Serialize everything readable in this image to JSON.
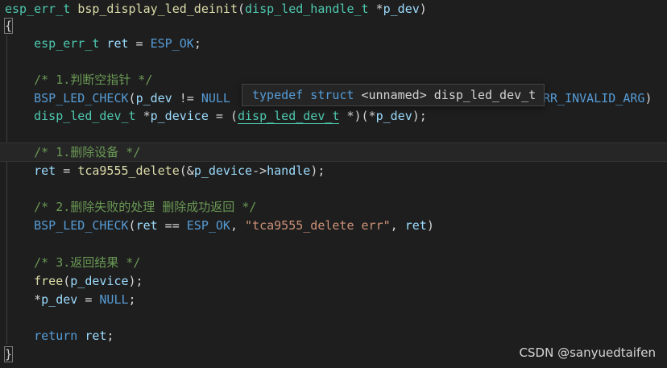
{
  "code": {
    "l1": {
      "ret_type": "esp_err_t",
      "fn": "bsp_display_led_deinit",
      "open": "(",
      "ptype": "disp_led_handle_t",
      "ptr": " *",
      "pname": "p_dev",
      "close": ")"
    },
    "l2": {
      "brace": "{"
    },
    "l3": {
      "type": "esp_err_t",
      "var": "ret",
      "eq": " = ",
      "val": "ESP_OK",
      "end": ";"
    },
    "l5": {
      "comment": "/* 1.判断空指针 */"
    },
    "l6": {
      "macro": "BSP_LED_CHECK",
      "open": "(",
      "var": "p_dev",
      "op": " != ",
      "null": "NULL",
      "tail_macro": "RR_INVALID_ARG",
      "tail_close": ")"
    },
    "l7": {
      "type": "disp_led_dev_t",
      "ptr": " *",
      "var": "p_device",
      "eq": " = (",
      "cast": "disp_led_dev_t",
      "cast_rest": " *)(*",
      "src": "p_dev",
      "end": ");"
    },
    "l9": {
      "comment": "/* 1.删除设备 */"
    },
    "l10": {
      "var": "ret",
      "eq": " = ",
      "fn": "tca9555_delete",
      "args": "(&",
      "arg": "p_device",
      "arrow": "->",
      "field": "handle",
      "end": ");"
    },
    "l12": {
      "comment": "/* 2.删除失败的处理 删除成功返回 */"
    },
    "l13": {
      "macro": "BSP_LED_CHECK",
      "open": "(",
      "var": "ret",
      "op": " == ",
      "ok": "ESP_OK",
      "comma": ", ",
      "str": "\"tca9555_delete err\"",
      "comma2": ", ",
      "var2": "ret",
      "end": ")"
    },
    "l15": {
      "comment": "/* 3.返回结果 */"
    },
    "l16": {
      "fn": "free",
      "open": "(",
      "var": "p_device",
      "end": ");"
    },
    "l17": {
      "ptr": "*",
      "var": "p_dev",
      "eq": " = ",
      "null": "NULL",
      "end": ";"
    },
    "l19": {
      "kw": "return",
      "sp": " ",
      "var": "ret",
      "end": ";"
    },
    "l20": {
      "brace": "}"
    }
  },
  "tooltip": {
    "kw1": "typedef",
    "kw2": "struct",
    "unnamed": "<unnamed>",
    "name": "disp_led_dev_t"
  },
  "watermark": "CSDN @sanyuedtaifen",
  "colors": {
    "background": "#1e1e1e",
    "type": "#4ec9b0",
    "keyword": "#569cd6",
    "function": "#dcdcaa",
    "variable": "#9cdcfe",
    "string": "#ce9178",
    "comment": "#6a9955"
  }
}
